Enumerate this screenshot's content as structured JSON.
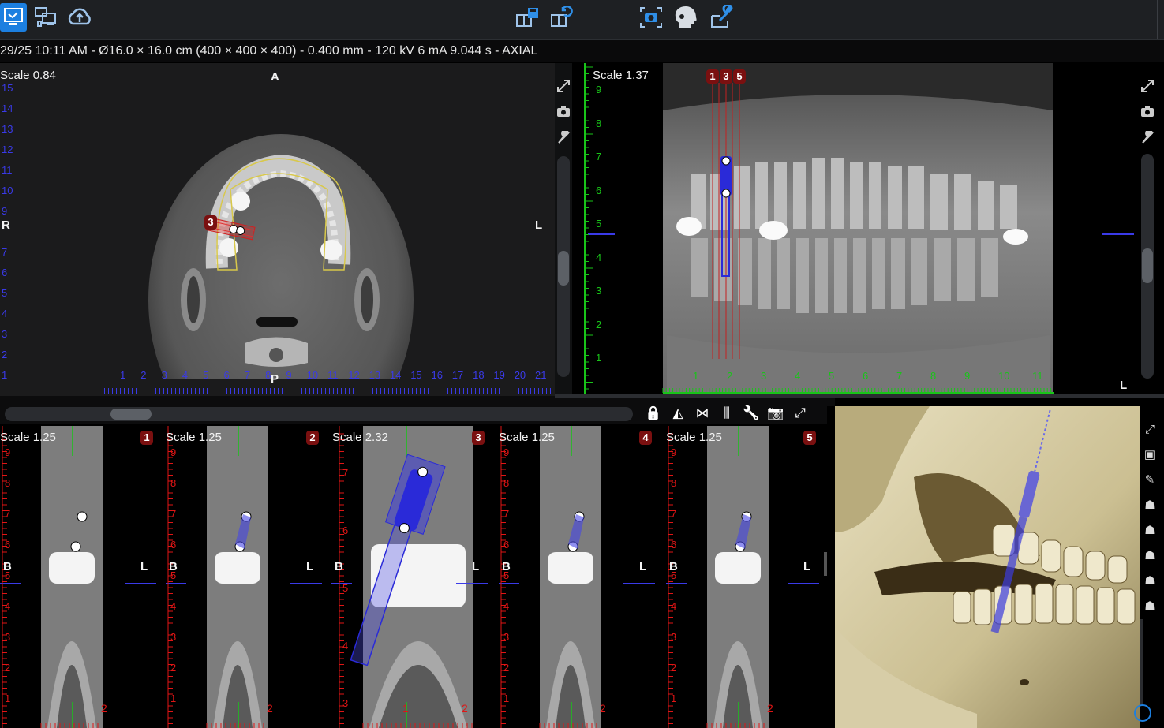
{
  "toolbar": {
    "left_buttons": [
      "workspace-icon",
      "layout-icon",
      "cloud-upload-icon"
    ],
    "center_buttons": [
      "save-layout-icon",
      "restore-layout-icon"
    ],
    "right_buttons": [
      "camera-icon",
      "skull-icon",
      "export-tools-icon"
    ]
  },
  "infobar": {
    "text": "29/25 10:11 AM - Ø16.0 × 16.0 cm (400 × 400 × 400) - 0.400 mm - 120 kV 6 mA 9.044 s - AXIAL"
  },
  "axial": {
    "scale": "Scale 0.84",
    "orient_top": "A",
    "orient_bottom": "P",
    "orient_left": "R",
    "orient_right": "L",
    "marker": "3",
    "left_ruler": [
      "15",
      "14",
      "13",
      "12",
      "11",
      "10",
      "9",
      "8",
      "7",
      "6",
      "5",
      "4",
      "3",
      "2",
      "1"
    ],
    "bottom_ruler": [
      "1",
      "2",
      "3",
      "4",
      "5",
      "6",
      "7",
      "8",
      "9",
      "10",
      "11",
      "12",
      "13",
      "14",
      "15",
      "16",
      "17",
      "18",
      "19",
      "20",
      "21"
    ]
  },
  "panoramic": {
    "scale": "Scale 1.37",
    "markers": [
      "1",
      "3",
      "5"
    ],
    "orient_right": "L",
    "left_ruler": [
      "9",
      "8",
      "7",
      "6",
      "5",
      "4",
      "3",
      "2",
      "1"
    ],
    "bottom_ruler": [
      "1",
      "2",
      "3",
      "4",
      "5",
      "6",
      "7",
      "8",
      "9",
      "10",
      "11"
    ]
  },
  "cross_sections": [
    {
      "scale": "Scale 1.25",
      "index": "1",
      "left": "B",
      "right": "L",
      "ruler": [
        "9",
        "8",
        "7",
        "6",
        "5",
        "4",
        "3",
        "2",
        "1"
      ],
      "bottom": "2"
    },
    {
      "scale": "Scale 1.25",
      "index": "2",
      "left": "B",
      "right": "L",
      "ruler": [
        "9",
        "8",
        "7",
        "6",
        "5",
        "4",
        "3",
        "2",
        "1"
      ],
      "bottom": "2"
    },
    {
      "scale": "Scale 2.32",
      "index": "3",
      "left": "B",
      "right": "L",
      "ruler": [
        "7",
        "6",
        "5",
        "4",
        "3"
      ],
      "bottom": "2",
      "bottom_left": "1"
    },
    {
      "scale": "Scale 1.25",
      "index": "4",
      "left": "B",
      "right": "L",
      "ruler": [
        "9",
        "8",
        "7",
        "6",
        "5",
        "4",
        "3",
        "2",
        "1"
      ],
      "bottom": "2"
    },
    {
      "scale": "Scale 1.25",
      "index": "5",
      "left": "B",
      "right": "L",
      "ruler": [
        "9",
        "8",
        "7",
        "6",
        "5",
        "4",
        "3",
        "2",
        "1"
      ],
      "bottom": "2"
    }
  ],
  "cross_toolbar": [
    "lock-icon",
    "flip-icon",
    "mirror-icon",
    "implant-icon",
    "wrench-icon",
    "camera-icon",
    "expand-icon"
  ],
  "render3d": {
    "side_buttons": [
      "expand-icon",
      "camera-icon",
      "wrench-icon",
      "skull-side-icon",
      "skull-front-icon",
      "skull-top-icon",
      "skull-back-icon",
      "skull-bottom-icon"
    ]
  },
  "colors": {
    "accent": "#1c7fe0",
    "marker_red": "#7a1010",
    "ruler_blue": "#3a3ae8",
    "ruler_green": "#19c419",
    "ruler_red": "#e01515",
    "implant_blue": "#2a2ad8"
  }
}
